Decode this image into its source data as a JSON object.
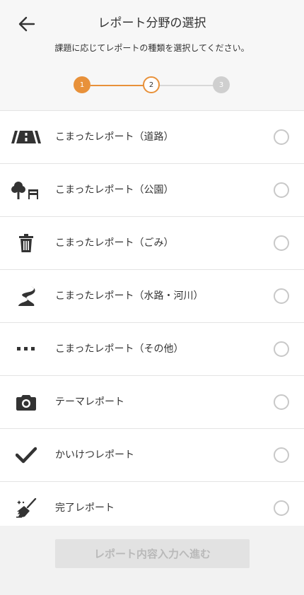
{
  "header": {
    "title": "レポート分野の選択",
    "subtitle": "課題に応じてレポートの種類を選択してください。"
  },
  "stepper": {
    "steps": [
      "1",
      "2",
      "3"
    ],
    "current": 2,
    "active_color": "#e8913a",
    "inactive_color": "#cfcfcf"
  },
  "report_types": [
    {
      "label": "こまったレポート（道路）",
      "icon": "road-icon"
    },
    {
      "label": "こまったレポート（公園）",
      "icon": "park-icon"
    },
    {
      "label": "こまったレポート（ごみ）",
      "icon": "trash-icon"
    },
    {
      "label": "こまったレポート（水路・河川）",
      "icon": "river-icon"
    },
    {
      "label": "こまったレポート（その他）",
      "icon": "more-icon"
    },
    {
      "label": "テーマレポート",
      "icon": "camera-icon"
    },
    {
      "label": "かいけつレポート",
      "icon": "check-icon"
    },
    {
      "label": "完了レポート",
      "icon": "broom-icon"
    }
  ],
  "footer": {
    "next_button": "レポート内容入力へ進む"
  }
}
